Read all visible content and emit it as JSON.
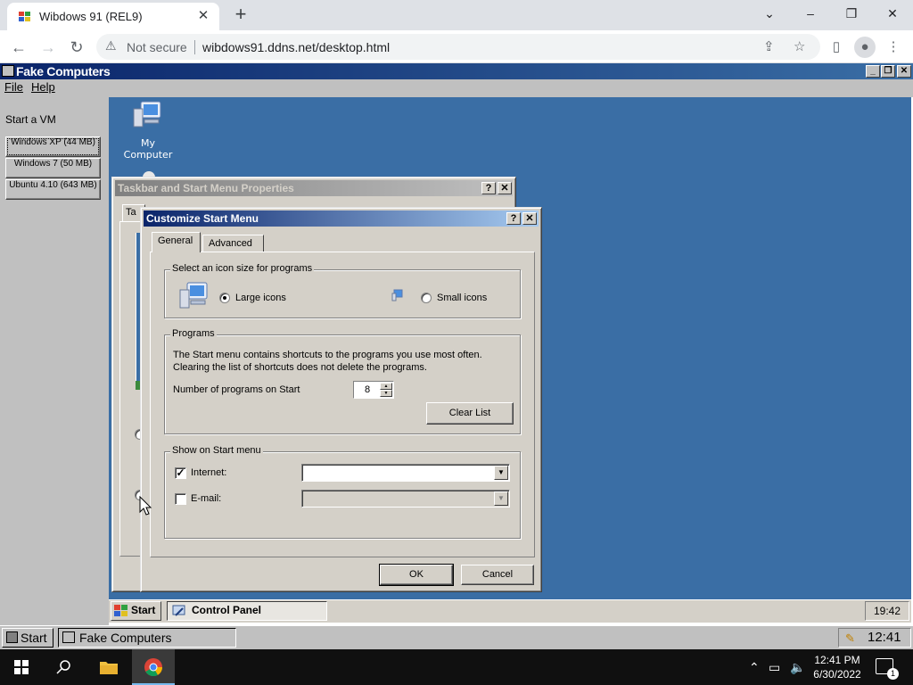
{
  "browser": {
    "tab_title": "Wibdows 91 (REL9)",
    "new_tab": "+",
    "security": "Not secure",
    "url": "wibdows91.ddns.net/desktop.html",
    "window_controls": {
      "minimize": "–",
      "maximize": "❐",
      "close": "✕"
    }
  },
  "app": {
    "title": "Fake Computers",
    "menu": {
      "file": "File",
      "help": "Help"
    },
    "title_buttons": {
      "minimize": "_",
      "restore": "❐",
      "close": "✕"
    }
  },
  "left_panel": {
    "heading": "Start a VM",
    "vms": [
      {
        "label": "Windows XP (44 MB)"
      },
      {
        "label": "Windows 7 (50 MB)"
      },
      {
        "label": "Ubuntu 4.10 (643 MB)"
      }
    ]
  },
  "desktop": {
    "icons": [
      {
        "label": "My Computer",
        "icon": "my-computer-icon"
      }
    ]
  },
  "taskbar_props": {
    "title": "Taskbar and Start Menu Properties",
    "tab_fragment": "Ta"
  },
  "customize": {
    "title": "Customize Start Menu",
    "tabs": [
      "General",
      "Advanced"
    ],
    "icon_size": {
      "legend": "Select an icon size for programs",
      "large": "Large icons",
      "small": "Small icons",
      "selected": "large"
    },
    "programs": {
      "legend": "Programs",
      "description": "The Start menu contains shortcuts to the programs you use most often.  Clearing the list of shortcuts does not delete the programs.",
      "count_label": "Number of programs on Start",
      "count_value": "8",
      "clear_button": "Clear List"
    },
    "show_on_start": {
      "legend": "Show on Start menu",
      "internet_label": "Internet:",
      "internet_checked": true,
      "email_label": "E-mail:",
      "email_checked": false
    },
    "ok": "OK",
    "cancel": "Cancel",
    "help_button": "?",
    "close_button": "✕"
  },
  "inner_taskbar": {
    "start": "Start",
    "task": "Control Panel",
    "clock": "19:42"
  },
  "outer_taskbar": {
    "start": "Start",
    "task": "Fake Computers",
    "clock": "12:41"
  },
  "host_taskbar": {
    "time": "12:41 PM",
    "date": "6/30/2022",
    "notification_count": "1"
  },
  "colors": {
    "desktop": "#3a6ea5",
    "title_active": "#0a246a",
    "face": "#d4d0c8"
  }
}
